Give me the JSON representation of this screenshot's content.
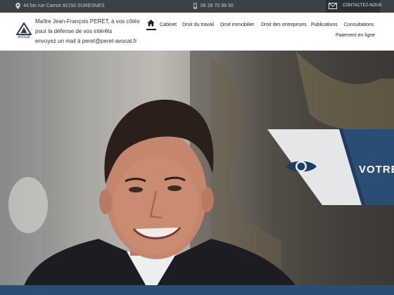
{
  "topbar": {
    "address": "44 bis rue Carnot 92150 SURESNES",
    "phone": "06 28 70 99 30",
    "contact_label": "CONTACTEZ-NOUS",
    "location_icon": "map-marker-icon",
    "phone_icon": "phone-icon",
    "mail_icon": "envelope-icon"
  },
  "logo": {
    "text": "avocat"
  },
  "intro": {
    "line1": "Maître Jean-François PERET, à vos côtés",
    "line2": "pour la défense de vos intérêts",
    "line3": "envoyez un mail à peret@peret-avocat.fr"
  },
  "nav": {
    "home_icon": "home-icon",
    "items": [
      {
        "label": "Cabinet"
      },
      {
        "label": "Droit du travail"
      },
      {
        "label": "Droit immobilier"
      },
      {
        "label": "Droit des entreprises"
      },
      {
        "label": "Publications"
      },
      {
        "label": "Consultations"
      },
      {
        "label": "Paiement en ligne"
      }
    ]
  },
  "hero": {
    "banner_text": "VOTRE",
    "banner_icon": "eye-icon"
  },
  "colors": {
    "topbar": "#3b4148",
    "banner_light": "#f2f4f6",
    "banner_dark": "#2a4d75",
    "accent": "#1e3c64"
  }
}
